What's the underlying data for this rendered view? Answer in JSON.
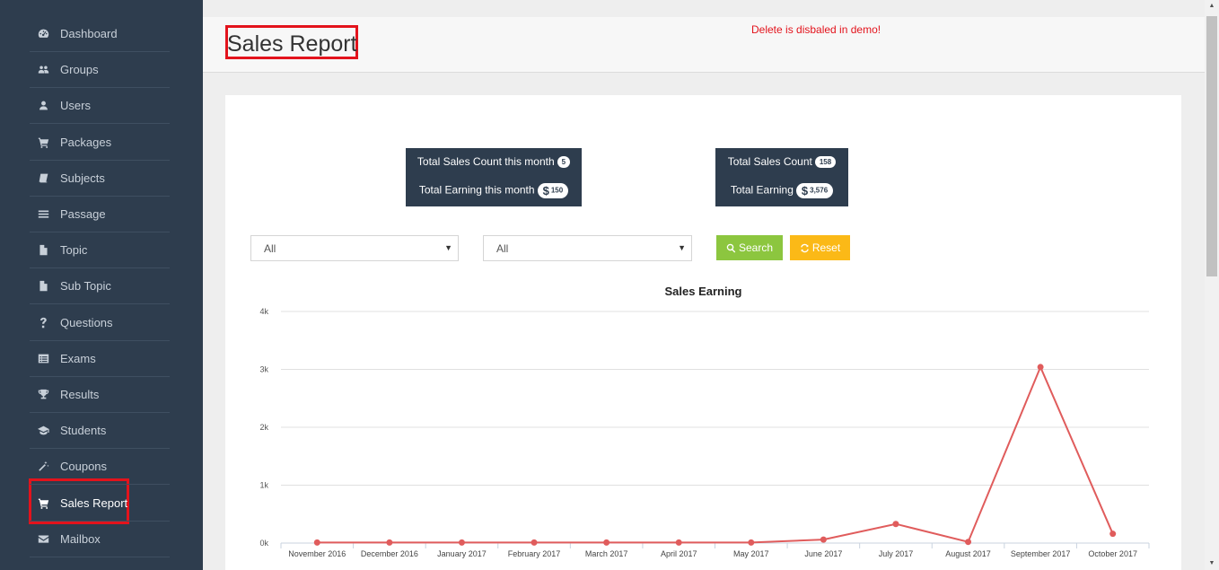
{
  "sidebar": {
    "items": [
      {
        "label": "Dashboard",
        "icon": "dashboard-icon"
      },
      {
        "label": "Groups",
        "icon": "users-group-icon"
      },
      {
        "label": "Users",
        "icon": "user-icon"
      },
      {
        "label": "Packages",
        "icon": "cart-icon"
      },
      {
        "label": "Subjects",
        "icon": "book-icon"
      },
      {
        "label": "Passage",
        "icon": "bars-icon"
      },
      {
        "label": "Topic",
        "icon": "file-icon"
      },
      {
        "label": "Sub Topic",
        "icon": "file-icon"
      },
      {
        "label": "Questions",
        "icon": "question-icon"
      },
      {
        "label": "Exams",
        "icon": "list-alt-icon"
      },
      {
        "label": "Results",
        "icon": "trophy-icon"
      },
      {
        "label": "Students",
        "icon": "graduation-cap-icon"
      },
      {
        "label": "Coupons",
        "icon": "magic-wand-icon"
      },
      {
        "label": "Sales Report",
        "icon": "cart-icon",
        "active": true
      },
      {
        "label": "Mailbox",
        "icon": "envelope-icon"
      }
    ]
  },
  "header": {
    "title": "Sales Report",
    "demo_message": "Delete is disbaled in demo!"
  },
  "stats": {
    "month": {
      "count_label": "Total Sales Count this month",
      "count_value": "5",
      "earning_label": "Total Earning this month",
      "earning_value": "150"
    },
    "total": {
      "count_label": "Total Sales Count",
      "count_value": "158",
      "earning_label": "Total Earning",
      "earning_value": "3,576"
    },
    "currency_symbol": "$"
  },
  "filters": {
    "select1_value": "All",
    "select2_value": "All",
    "search_label": "Search",
    "reset_label": "Reset"
  },
  "colors": {
    "sidebar_bg": "#2e3d4e",
    "highlight": "#e3131c",
    "search_btn": "#8cc63f",
    "reset_btn": "#fbb917",
    "line": "#e05c5c"
  },
  "chart_data": {
    "type": "line",
    "title": "Sales Earning",
    "categories": [
      "November 2016",
      "December 2016",
      "January 2017",
      "February 2017",
      "March 2017",
      "April 2017",
      "May 2017",
      "June 2017",
      "July 2017",
      "August 2017",
      "September 2017",
      "October 2017"
    ],
    "series": [
      {
        "values": [
          10,
          10,
          10,
          10,
          10,
          10,
          10,
          60,
          330,
          20,
          3040,
          160
        ]
      }
    ],
    "y_ticks": [
      "0k",
      "1k",
      "2k",
      "3k",
      "4k"
    ],
    "ylim": [
      0,
      4000
    ],
    "grid": true,
    "legend": "none"
  }
}
